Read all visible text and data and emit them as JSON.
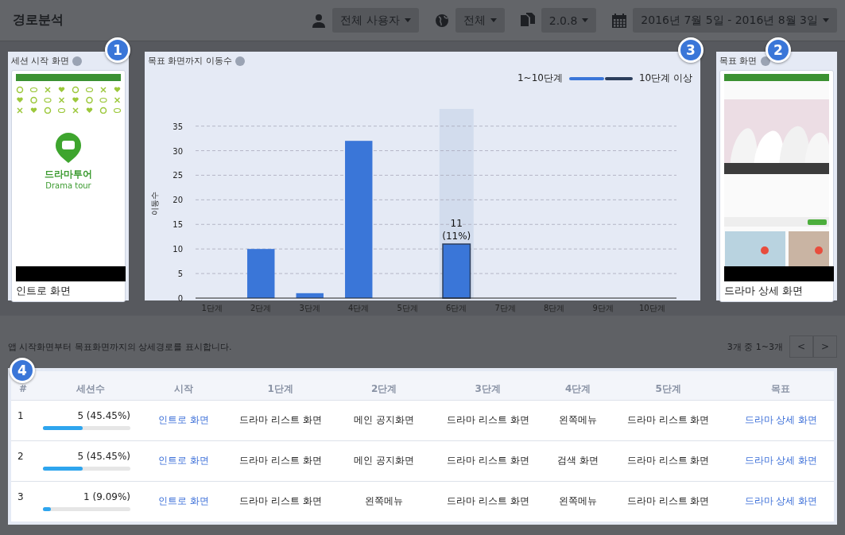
{
  "header": {
    "title": "경로분석",
    "filters": [
      {
        "kind": "user",
        "label": "전체 사용자"
      },
      {
        "kind": "globe",
        "label": "전체"
      },
      {
        "kind": "files",
        "label": "2.0.8"
      },
      {
        "kind": "calendar",
        "label": "2016년 7월 5일 - 2016년 8월 3일"
      }
    ]
  },
  "start_panel": {
    "title": "세션 시작 화면",
    "badge": "1",
    "thumbnail": {
      "kind": "intro",
      "app_name": "드라마투어",
      "app_name_en": "Drama tour"
    },
    "caption": "인트로 화면"
  },
  "chart_panel": {
    "title": "목표 화면까지 이동수",
    "badge": "3",
    "chart_data": {
      "type": "bar",
      "ylabel": "이동수",
      "categories": [
        "1단계",
        "2단계",
        "3단계",
        "4단계",
        "5단계",
        "6단계",
        "7단계",
        "8단계",
        "9단계",
        "10단계"
      ],
      "series": [
        {
          "name": "1~10단계",
          "color": "#3a76d8",
          "values": [
            0,
            10,
            1,
            32,
            0,
            11,
            0,
            0,
            0,
            0
          ]
        },
        {
          "name": "10단계 이상",
          "color": "#2c3e5c",
          "values": [
            null,
            null,
            null,
            null,
            null,
            null,
            null,
            null,
            null,
            null
          ]
        }
      ],
      "ylim": [
        0,
        35
      ],
      "yticks": [
        0,
        5,
        10,
        15,
        20,
        25,
        30,
        35
      ],
      "grid": true,
      "annotations": [
        {
          "x": "6단계",
          "y": 11,
          "text": "11"
        },
        {
          "x": "6단계",
          "y": 11,
          "text": "(11%)"
        }
      ]
    }
  },
  "goal_panel": {
    "title": "목표 화면",
    "badge": "2",
    "caption": "드라마 상세 화면"
  },
  "paths": {
    "description": "앱 시작화면부터 목표화면까지의 상세경로를 표시합니다.",
    "badge": "4",
    "pager": {
      "summary": "3개 중 1~3개",
      "prev": "<",
      "next": ">"
    },
    "columns": [
      "#",
      "세션수",
      "시작",
      "1단계",
      "2단계",
      "3단계",
      "4단계",
      "5단계",
      "목표"
    ],
    "rows": [
      {
        "index": "1",
        "sessions": "5 (45.45%)",
        "level": 0.4545,
        "steps": [
          "인트로 화면",
          "드라마 리스트 화면",
          "메인 공지화면",
          "드라마 리스트 화면",
          "왼쪽메뉴",
          "드라마 리스트 화면",
          "드라마 상세 화면"
        ]
      },
      {
        "index": "2",
        "sessions": "5 (45.45%)",
        "level": 0.4545,
        "steps": [
          "인트로 화면",
          "드라마 리스트 화면",
          "메인 공지화면",
          "드라마 리스트 화면",
          "검색 화면",
          "드라마 리스트 화면",
          "드라마 상세 화면"
        ]
      },
      {
        "index": "3",
        "sessions": "1 (9.09%)",
        "level": 0.0909,
        "steps": [
          "인트로 화면",
          "드라마 리스트 화면",
          "왼쪽메뉴",
          "드라마 리스트 화면",
          "왼쪽메뉴",
          "드라마 리스트 화면",
          "드라마 상세 화면"
        ]
      }
    ]
  }
}
